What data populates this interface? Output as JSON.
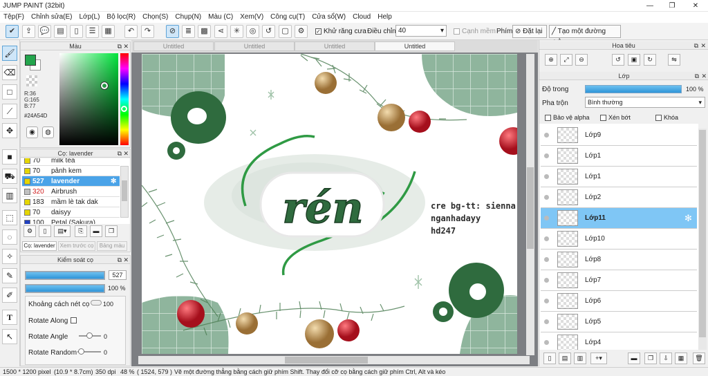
{
  "app": {
    "title": "JUMP PAINT (32bit)"
  },
  "menu": [
    "Tệp(F)",
    "Chỉnh sửa(E)",
    "Lớp(L)",
    "Bộ lọc(R)",
    "Chọn(S)",
    "Chụp(N)",
    "Màu (C)",
    "Xem(V)",
    "Công cụ(T)",
    "Cửa sổ(W)",
    "Cloud",
    "Help"
  ],
  "toolbar": {
    "antialias": "Khử răng cưa",
    "adjust_label": "Điều chỉnh",
    "adjust_value": "40",
    "edge": "Cạnh mềm",
    "keys": "Phím",
    "reset": "Đặt lại",
    "create_line": "Tạo một đường thẳng"
  },
  "color_panel": {
    "title": "Màu",
    "r": "R:36",
    "g": "G:165",
    "b": "B:77",
    "hex": "#24A54D",
    "current": "#24A54D"
  },
  "brush_panel": {
    "title": "Cọ: lavender",
    "items": [
      {
        "size": "70",
        "name": "milk tea",
        "color": "#e5d600"
      },
      {
        "size": "70",
        "name": "pảnh kem",
        "color": "#e5d600"
      },
      {
        "size": "527",
        "name": "lavender",
        "color": "#e5d600",
        "selected": true
      },
      {
        "size": "320",
        "name": "Airbrush",
        "color": "#c0c0c0",
        "red": true
      },
      {
        "size": "183",
        "name": "mầm lè tak dak",
        "color": "#e5d600"
      },
      {
        "size": "70",
        "name": "daisyy",
        "color": "#e5d600"
      },
      {
        "size": "100",
        "name": "Petal (Sakura)",
        "color": "#2040c0"
      }
    ],
    "tabs": [
      "Cọ: lavender",
      "Xem trước cọ",
      "Bảng màu"
    ]
  },
  "control_panel": {
    "title": "Kiểm soát cọ",
    "size": "527",
    "opacity": "100 %",
    "size_fill": 1.0,
    "opacity_fill": 1.0,
    "rows": [
      {
        "label": "Khoảng cách nét cọ",
        "value": "100"
      },
      {
        "label": "Rotate Along",
        "value": ""
      },
      {
        "label": "Rotate Angle",
        "value": "0"
      },
      {
        "label": "Rotate Random",
        "value": "0"
      }
    ]
  },
  "tabs": [
    "Untitled",
    "Untitled",
    "Untitled",
    "Untitled"
  ],
  "canvas": {
    "word": "rén",
    "credit": [
      "cre bg-tt: sienna",
      "nganhadayy",
      "hd247"
    ]
  },
  "navigator": {
    "title": "Hoa tiêu"
  },
  "layers": {
    "title": "Lớp",
    "opacity_label": "Độ trong",
    "opacity_value": "100 %",
    "blend_label": "Pha trộn",
    "blend_value": "Bình thường",
    "protect_alpha": "Bảo vệ alpha",
    "clip": "Xén bớt",
    "lock": "Khóa",
    "items": [
      {
        "name": "Lớp9"
      },
      {
        "name": "Lớp1"
      },
      {
        "name": "Lớp1"
      },
      {
        "name": "Lớp2"
      },
      {
        "name": "Lớp11",
        "selected": true
      },
      {
        "name": "Lớp10"
      },
      {
        "name": "Lớp8"
      },
      {
        "name": "Lớp7"
      },
      {
        "name": "Lớp6"
      },
      {
        "name": "Lớp5"
      },
      {
        "name": "Lớp4"
      }
    ]
  },
  "status": {
    "size": "1500 * 1200 pixel",
    "cm": "(10.9 * 8.7cm)",
    "dpi": "350 dpi",
    "zoom": "48 %",
    "coords": "( 1524, 579 )",
    "hint": "Vẽ một đường thẳng bằng cách giữ phím Shift. Thay đổi cỡ cọ bằng cách giữ phím Ctrl, Alt và kéo"
  }
}
